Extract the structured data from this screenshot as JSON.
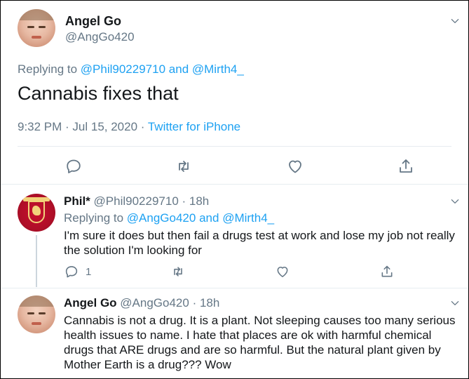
{
  "main_tweet": {
    "name": "Angel Go",
    "handle": "@AngGo420",
    "replying_prefix": "Replying to",
    "replying_to_1": "@Phil90229710",
    "replying_and": "and",
    "replying_to_2": "@Mirth4_",
    "text": "Cannabis fixes that",
    "timestamp": "9:32 PM · Jul 15, 2020 ·",
    "source": "Twitter for iPhone",
    "actions": [
      "reply-icon",
      "retweet-icon",
      "like-icon",
      "share-icon"
    ]
  },
  "replies": [
    {
      "name": "Phil*",
      "handle": "@Phil90229710 · 18h",
      "avatar": "liverpool-crest-avatar",
      "replying_prefix": "Replying to",
      "replying_to_1": "@AngGo420",
      "replying_and": "and",
      "replying_to_2": "@Mirth4_",
      "text": "I'm sure it does but then fail a drugs test at work and lose my job not really the solution I'm looking for",
      "reply_count": "1"
    },
    {
      "name": "Angel Go",
      "handle": "@AngGo420 · 18h",
      "avatar": "angel-go-avatar",
      "text": "Cannabis is not a drug. It is a plant. Not sleeping causes too many serious health issues to name. I hate that places are ok with harmful chemical drugs that ARE drugs and are so harmful. But the natural plant given by Mother Earth is a drug??? Wow"
    }
  ],
  "colors": {
    "link": "#1da1f2",
    "secondary_text": "#657786",
    "primary_text": "#14171a",
    "divider": "#e6ecf0"
  }
}
